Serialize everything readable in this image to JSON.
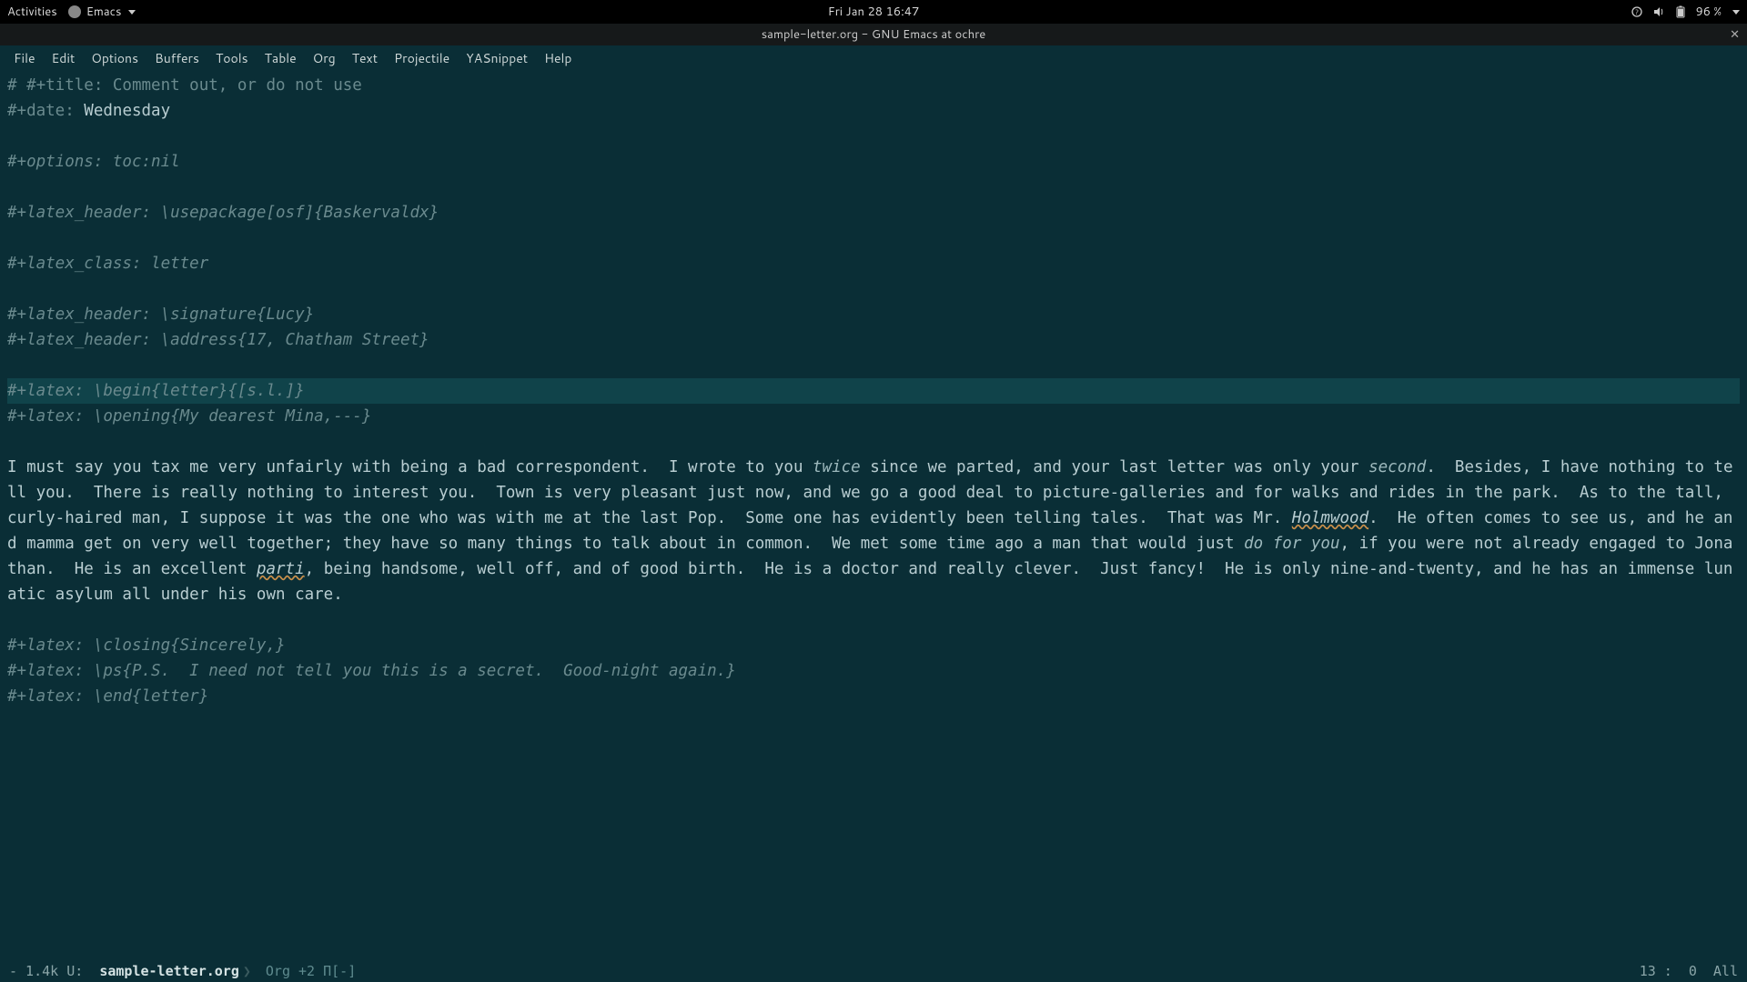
{
  "topbar": {
    "activities": "Activities",
    "app_name": "Emacs",
    "datetime": "Fri Jan 28  16:47",
    "battery": "96 %"
  },
  "titlebar": {
    "title": "sample-letter.org - GNU Emacs at ochre"
  },
  "menubar": [
    "File",
    "Edit",
    "Options",
    "Buffers",
    "Tools",
    "Table",
    "Org",
    "Text",
    "Projectile",
    "YASnippet",
    "Help"
  ],
  "buffer": {
    "l1_comment": "# #+title: Comment out, or do not use",
    "l2_key": "#+date: ",
    "l2_val": "Wednesday",
    "l3": "#+options: toc:nil",
    "l4": "#+latex_header: \\usepackage[osf]{Baskervaldx}",
    "l5": "#+latex_class: letter",
    "l6": "#+latex_header: \\signature{Lucy}",
    "l7": "#+latex_header: \\address{17, Chatham Street}",
    "l8": "#+latex: \\begin{letter}{[s.l.]}",
    "l9": "#+latex: \\opening{My dearest Mina,---}",
    "body_a": "I must say you tax me very unfairly with being a bad correspondent.  I wrote to you ",
    "body_twice": "twice",
    "body_b": " since we parted, and your last letter was only your ",
    "body_second": "second",
    "body_c": ".  Besides, I have nothing to tell you.  There is really nothing to interest you.  Town is very pleasant just now, and we go a good deal to picture-galleries and for walks and rides in the park.  As to the tall, curly-haired man, I suppose it was the one who was with me at the last Pop.  Some one has evidently been telling tales.  That was Mr. ",
    "body_holmwood": "Holmwood",
    "body_d": ".  He often comes to see us, and he and mamma get on very well together; they have so many things to talk about in common.  We met some time ago a man that would just ",
    "body_dofor": "do for you",
    "body_e": ", if you were not already engaged to Jonathan.  He is an excellent ",
    "body_parti": "parti",
    "body_f": ", being handsome, well off, and of good birth.  He is a doctor and really clever.  Just fancy!  He is only nine-and-twenty, and he has an immense lunatic asylum all under his own care.",
    "l10": "#+latex: \\closing{Sincerely,}",
    "l11": "#+latex: \\ps{P.S.  I need not tell you this is a secret.  Good-night again.}",
    "l12": "#+latex: \\end{letter}"
  },
  "modeline": {
    "left_prefix": "- 1.4k U:",
    "filename": "sample-letter.org",
    "mode": "Org +2 Π[-]",
    "line": "13",
    "col": "0",
    "pos": "All"
  }
}
